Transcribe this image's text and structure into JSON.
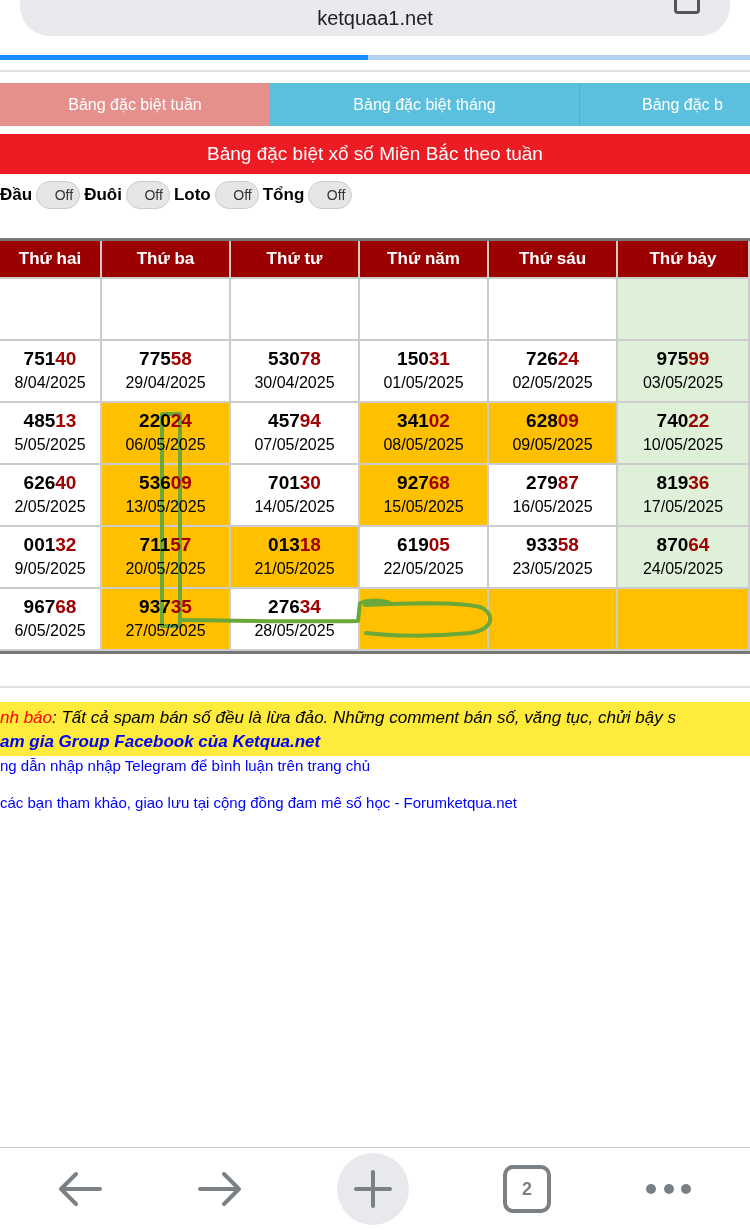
{
  "address_bar": {
    "url": "ketquaa1.net"
  },
  "progress": {
    "level": 0.49
  },
  "tabs": [
    {
      "label": "Bảng đặc biệt tuần",
      "selected": true
    },
    {
      "label": "Bảng đặc biệt tháng",
      "selected": false
    },
    {
      "label": "Bảng đặc b",
      "selected": false
    }
  ],
  "title": "Bảng đặc biệt xổ số Miền Bắc theo tuần",
  "toggles": [
    {
      "label": "Đầu",
      "state": "Off",
      "on": false
    },
    {
      "label": "Đuôi",
      "state": "Off",
      "on": false
    },
    {
      "label": "Loto",
      "state": "Off",
      "on": false
    },
    {
      "label": "Tổng",
      "state": "Off",
      "on": false
    }
  ],
  "table": {
    "columns": [
      {
        "label": "Thứ hai",
        "shaded": false
      },
      {
        "label": "Thứ ba",
        "shaded": false
      },
      {
        "label": "Thứ tư",
        "shaded": false
      },
      {
        "label": "Thứ năm",
        "shaded": false
      },
      {
        "label": "Thứ sáu",
        "shaded": false
      },
      {
        "label": "Thứ bảy",
        "shaded": true
      }
    ],
    "rows": [
      [
        {
          "highlighted": false
        },
        {
          "highlighted": false
        },
        {
          "highlighted": false
        },
        {
          "highlighted": false
        },
        {
          "highlighted": false
        },
        {
          "highlighted": false
        }
      ],
      [
        {
          "head": "751",
          "tail": "40",
          "date": "8/04/2025",
          "highlighted": false
        },
        {
          "head": "775",
          "tail": "58",
          "date": "29/04/2025",
          "highlighted": false
        },
        {
          "head": "530",
          "tail": "78",
          "date": "30/04/2025",
          "highlighted": false
        },
        {
          "head": "150",
          "tail": "31",
          "date": "01/05/2025",
          "highlighted": false
        },
        {
          "head": "726",
          "tail": "24",
          "date": "02/05/2025",
          "highlighted": false
        },
        {
          "head": "975",
          "tail": "99",
          "date": "03/05/2025",
          "highlighted": false
        }
      ],
      [
        {
          "head": "485",
          "tail": "13",
          "date": "5/05/2025",
          "highlighted": false
        },
        {
          "head": "220",
          "tail": "24",
          "date": "06/05/2025",
          "highlighted": true
        },
        {
          "head": "457",
          "tail": "94",
          "date": "07/05/2025",
          "highlighted": false
        },
        {
          "head": "341",
          "tail": "02",
          "date": "08/05/2025",
          "highlighted": true
        },
        {
          "head": "628",
          "tail": "09",
          "date": "09/05/2025",
          "highlighted": true
        },
        {
          "head": "740",
          "tail": "22",
          "date": "10/05/2025",
          "highlighted": false
        }
      ],
      [
        {
          "head": "626",
          "tail": "40",
          "date": "2/05/2025",
          "highlighted": false
        },
        {
          "head": "536",
          "tail": "09",
          "date": "13/05/2025",
          "highlighted": true
        },
        {
          "head": "701",
          "tail": "30",
          "date": "14/05/2025",
          "highlighted": false
        },
        {
          "head": "927",
          "tail": "68",
          "date": "15/05/2025",
          "highlighted": true
        },
        {
          "head": "279",
          "tail": "87",
          "date": "16/05/2025",
          "highlighted": false
        },
        {
          "head": "819",
          "tail": "36",
          "date": "17/05/2025",
          "highlighted": false
        }
      ],
      [
        {
          "head": "001",
          "tail": "32",
          "date": "9/05/2025",
          "highlighted": false
        },
        {
          "head": "711",
          "tail": "57",
          "date": "20/05/2025",
          "highlighted": true
        },
        {
          "head": "013",
          "tail": "18",
          "date": "21/05/2025",
          "highlighted": true
        },
        {
          "head": "619",
          "tail": "05",
          "date": "22/05/2025",
          "highlighted": false
        },
        {
          "head": "933",
          "tail": "58",
          "date": "23/05/2025",
          "highlighted": false
        },
        {
          "head": "870",
          "tail": "64",
          "date": "24/05/2025",
          "highlighted": false
        }
      ],
      [
        {
          "head": "967",
          "tail": "68",
          "date": "6/05/2025",
          "highlighted": false
        },
        {
          "head": "937",
          "tail": "35",
          "date": "27/05/2025",
          "highlighted": true
        },
        {
          "head": "276",
          "tail": "34",
          "date": "28/05/2025",
          "highlighted": false
        },
        {
          "highlighted": true
        },
        {
          "highlighted": true
        },
        {
          "highlighted": true
        }
      ]
    ]
  },
  "notice": {
    "label": "nh báo",
    "text": ": Tất cả spam bán số đều là lừa đảo. Những comment bán số, văng tục, chửi bậy s",
    "link": "am gia Group Facebook của Ketqua.net"
  },
  "links": [
    "ng dẫn nhập nhập Telegram để bình luận trên trang chủ",
    "các bạn tham khảo, giao lưu tại cộng đồng đam mê số học - Forumketqua.net"
  ],
  "bottom_nav": {
    "tab_count": "2"
  }
}
